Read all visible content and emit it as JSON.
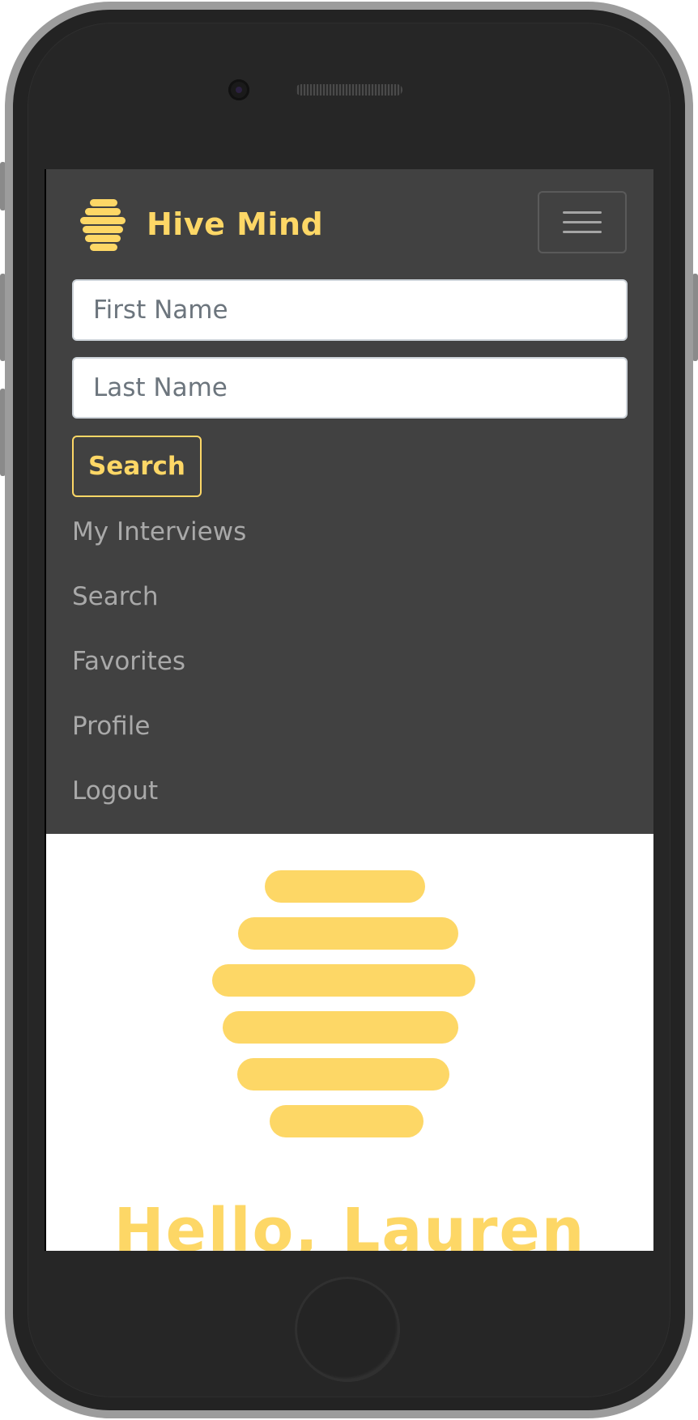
{
  "app": {
    "brand_name": "Hive Mind",
    "brand_color": "#fdd766",
    "navbar_color": "#414141"
  },
  "search": {
    "first_name_placeholder": "First Name",
    "last_name_placeholder": "Last Name",
    "button_label": "Search"
  },
  "nav": {
    "items": [
      {
        "label": "My Interviews"
      },
      {
        "label": "Search"
      },
      {
        "label": "Favorites"
      },
      {
        "label": "Profile"
      },
      {
        "label": "Logout"
      }
    ]
  },
  "main": {
    "greeting": "Hello, Lauren"
  },
  "icons": {
    "brand": "hive-logo-icon",
    "menu": "hamburger-menu-icon",
    "hero": "hive-logo-icon"
  }
}
